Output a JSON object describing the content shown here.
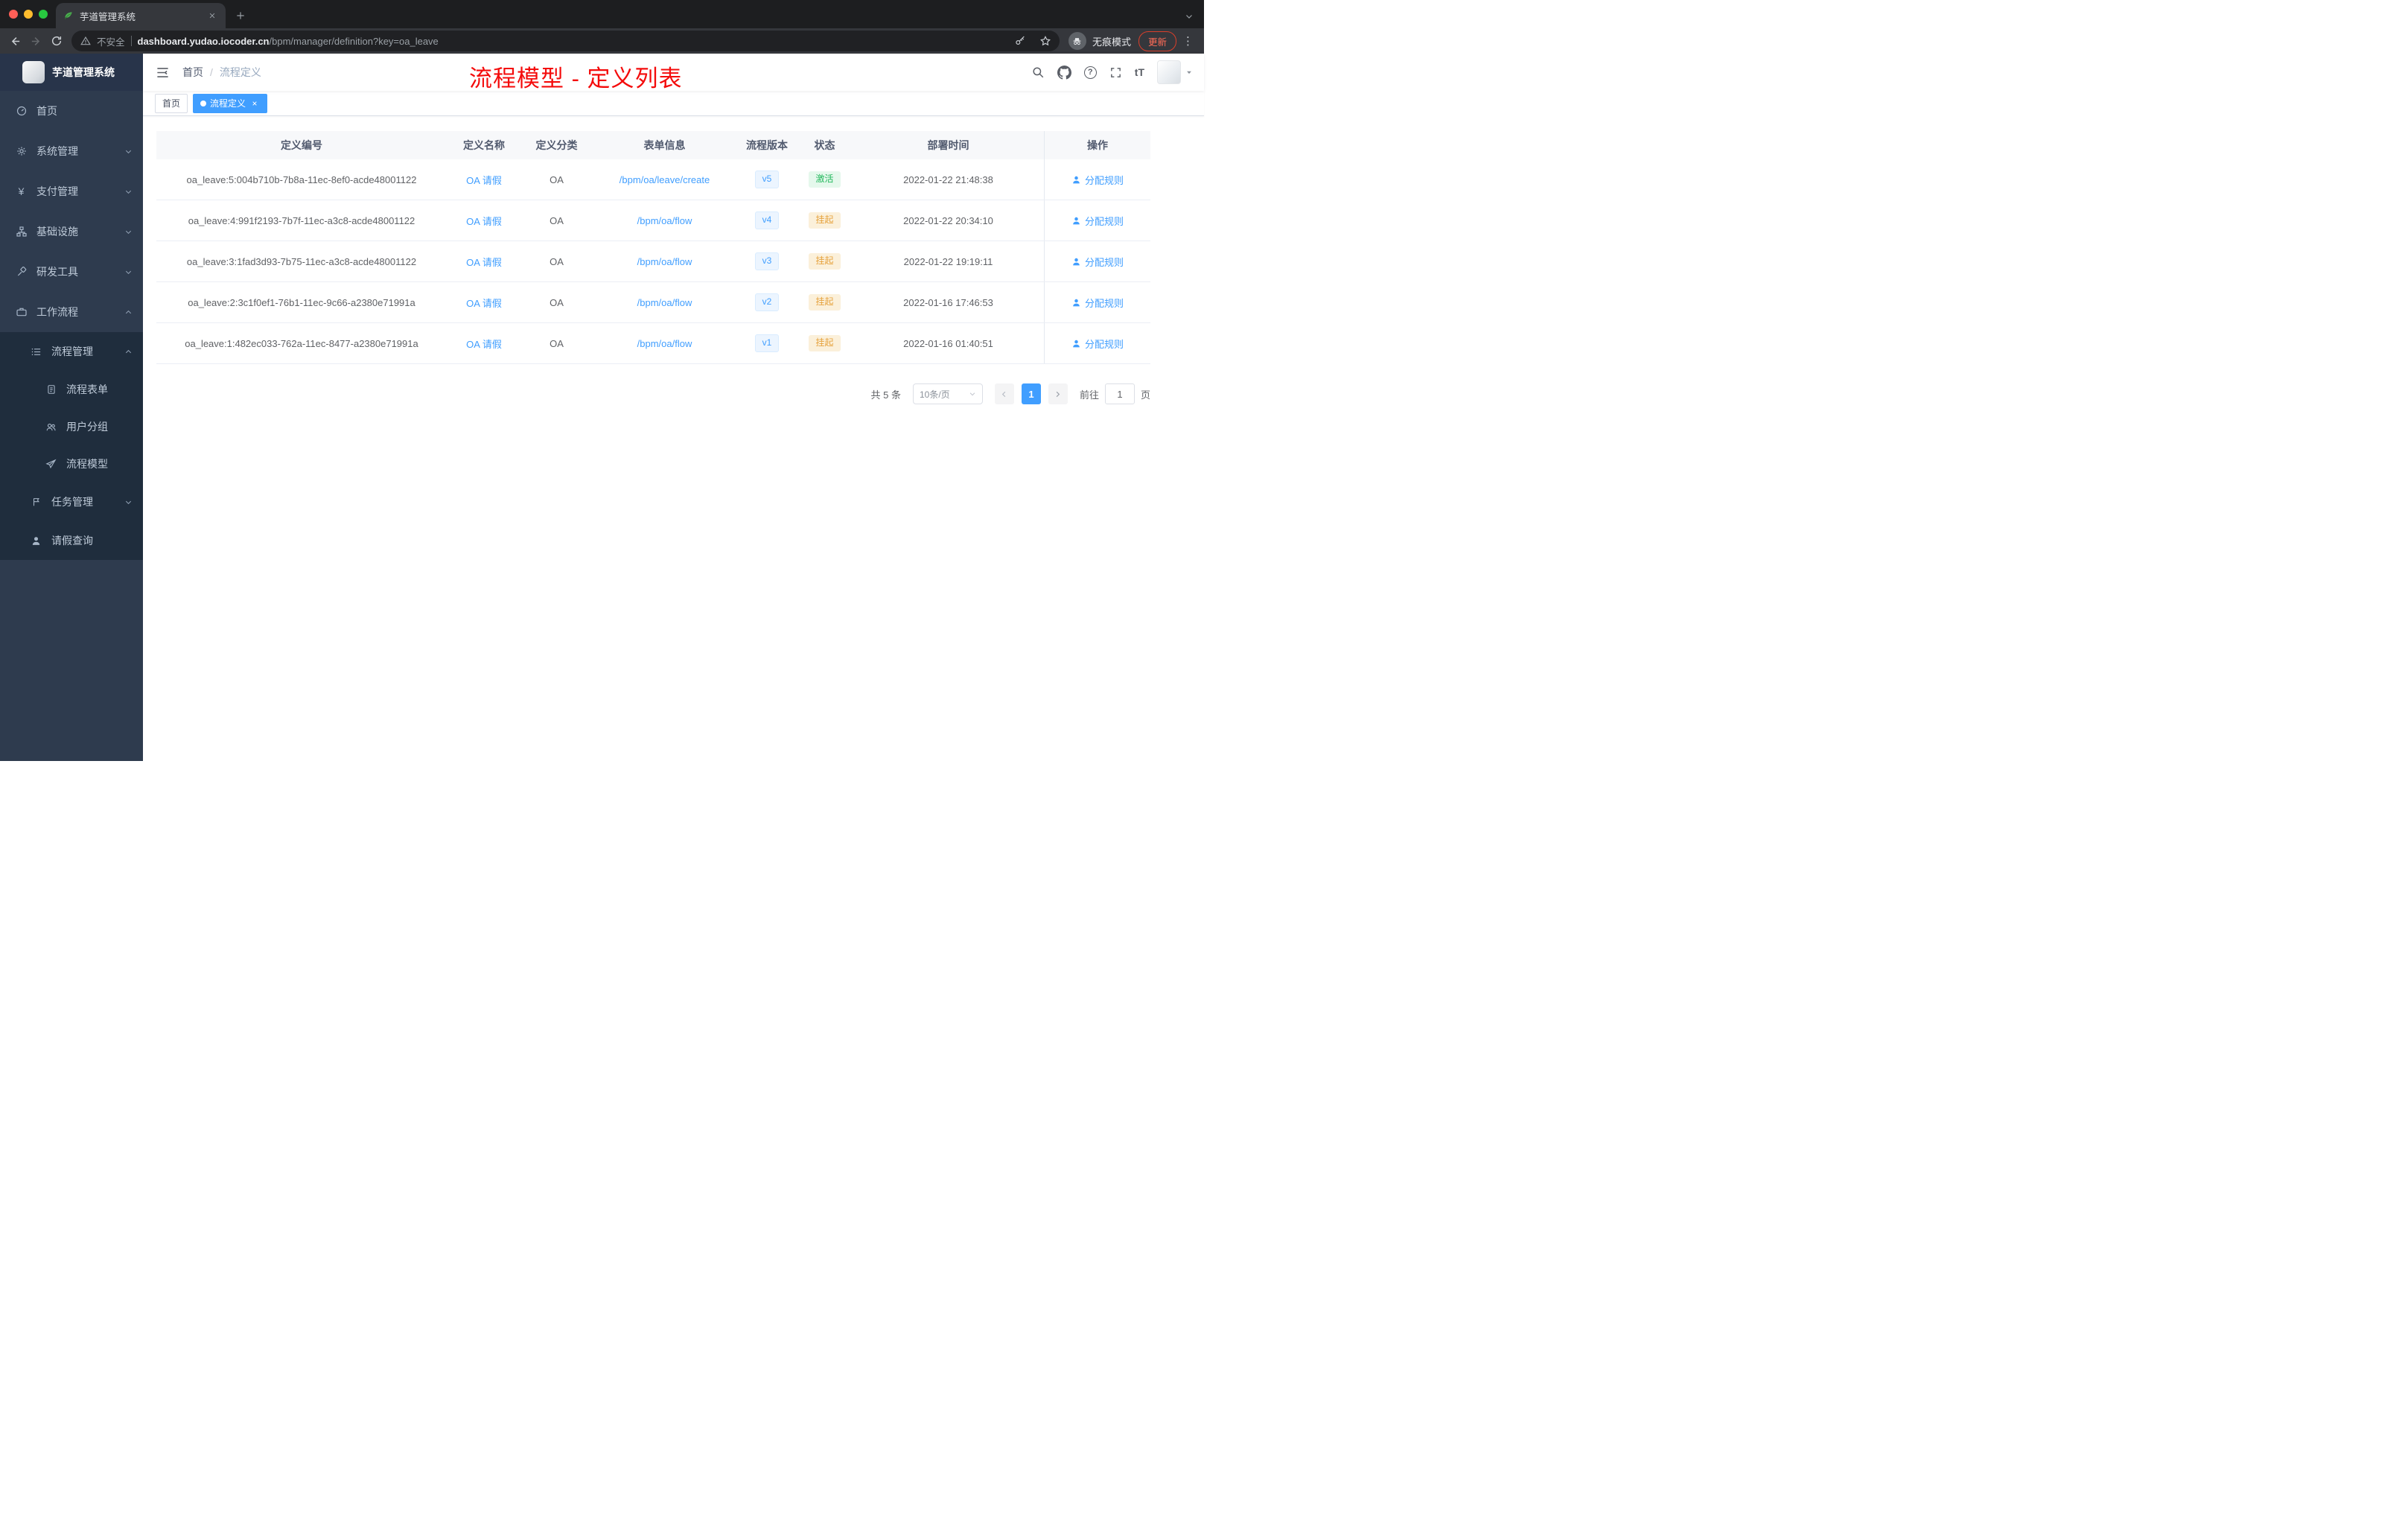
{
  "browser": {
    "tab_title": "芋道管理系统",
    "security_label": "不安全",
    "url_host": "dashboard.yudao.iocoder.cn",
    "url_path": "/bpm/manager/definition?key=oa_leave",
    "incognito_label": "无痕模式",
    "update_label": "更新",
    "menu_dots": "⋮"
  },
  "glyphs": {
    "question": "?",
    "font_size": "tT",
    "yen": "¥"
  },
  "sidebar": {
    "logo_title": "芋道管理系统",
    "items": [
      {
        "label": "首页"
      },
      {
        "label": "系统管理"
      },
      {
        "label": "支付管理"
      },
      {
        "label": "基础设施"
      },
      {
        "label": "研发工具"
      },
      {
        "label": "工作流程"
      },
      {
        "label": "流程管理"
      },
      {
        "label": "流程表单"
      },
      {
        "label": "用户分组"
      },
      {
        "label": "流程模型"
      },
      {
        "label": "任务管理"
      },
      {
        "label": "请假查询"
      }
    ]
  },
  "header": {
    "breadcrumb": {
      "home": "首页",
      "separator": "/",
      "current": "流程定义"
    }
  },
  "annotation": "流程模型 - 定义列表",
  "tags": {
    "home": "首页",
    "active": "流程定义"
  },
  "table": {
    "headers": [
      "定义编号",
      "定义名称",
      "定义分类",
      "表单信息",
      "流程版本",
      "状态",
      "部署时间",
      "操作"
    ],
    "action_label": "分配规则",
    "rows": [
      {
        "id": "oa_leave:5:004b710b-7b8a-11ec-8ef0-acde48001122",
        "name": "OA 请假",
        "category": "OA",
        "form": "/bpm/oa/leave/create",
        "version": "v5",
        "status": "激活",
        "time": "2022-01-22 21:48:38"
      },
      {
        "id": "oa_leave:4:991f2193-7b7f-11ec-a3c8-acde48001122",
        "name": "OA 请假",
        "category": "OA",
        "form": "/bpm/oa/flow",
        "version": "v4",
        "status": "挂起",
        "time": "2022-01-22 20:34:10"
      },
      {
        "id": "oa_leave:3:1fad3d93-7b75-11ec-a3c8-acde48001122",
        "name": "OA 请假",
        "category": "OA",
        "form": "/bpm/oa/flow",
        "version": "v3",
        "status": "挂起",
        "time": "2022-01-22 19:19:11"
      },
      {
        "id": "oa_leave:2:3c1f0ef1-76b1-11ec-9c66-a2380e71991a",
        "name": "OA 请假",
        "category": "OA",
        "form": "/bpm/oa/flow",
        "version": "v2",
        "status": "挂起",
        "time": "2022-01-16 17:46:53"
      },
      {
        "id": "oa_leave:1:482ec033-762a-11ec-8477-a2380e71991a",
        "name": "OA 请假",
        "category": "OA",
        "form": "/bpm/oa/flow",
        "version": "v1",
        "status": "挂起",
        "time": "2022-01-16 01:40:51"
      }
    ]
  },
  "pagination": {
    "total": "共 5 条",
    "page_size": "10条/页",
    "page": "1",
    "goto_label": "前往",
    "goto_value": "1",
    "goto_unit": "页"
  },
  "colors": {
    "accent": "#409eff",
    "success": "#23b85c",
    "warning": "#e6a23c",
    "annotation_red": "#f40b0b",
    "sidebar_bg": "#2e3b4e",
    "submenu_bg": "#1f2d3d"
  }
}
